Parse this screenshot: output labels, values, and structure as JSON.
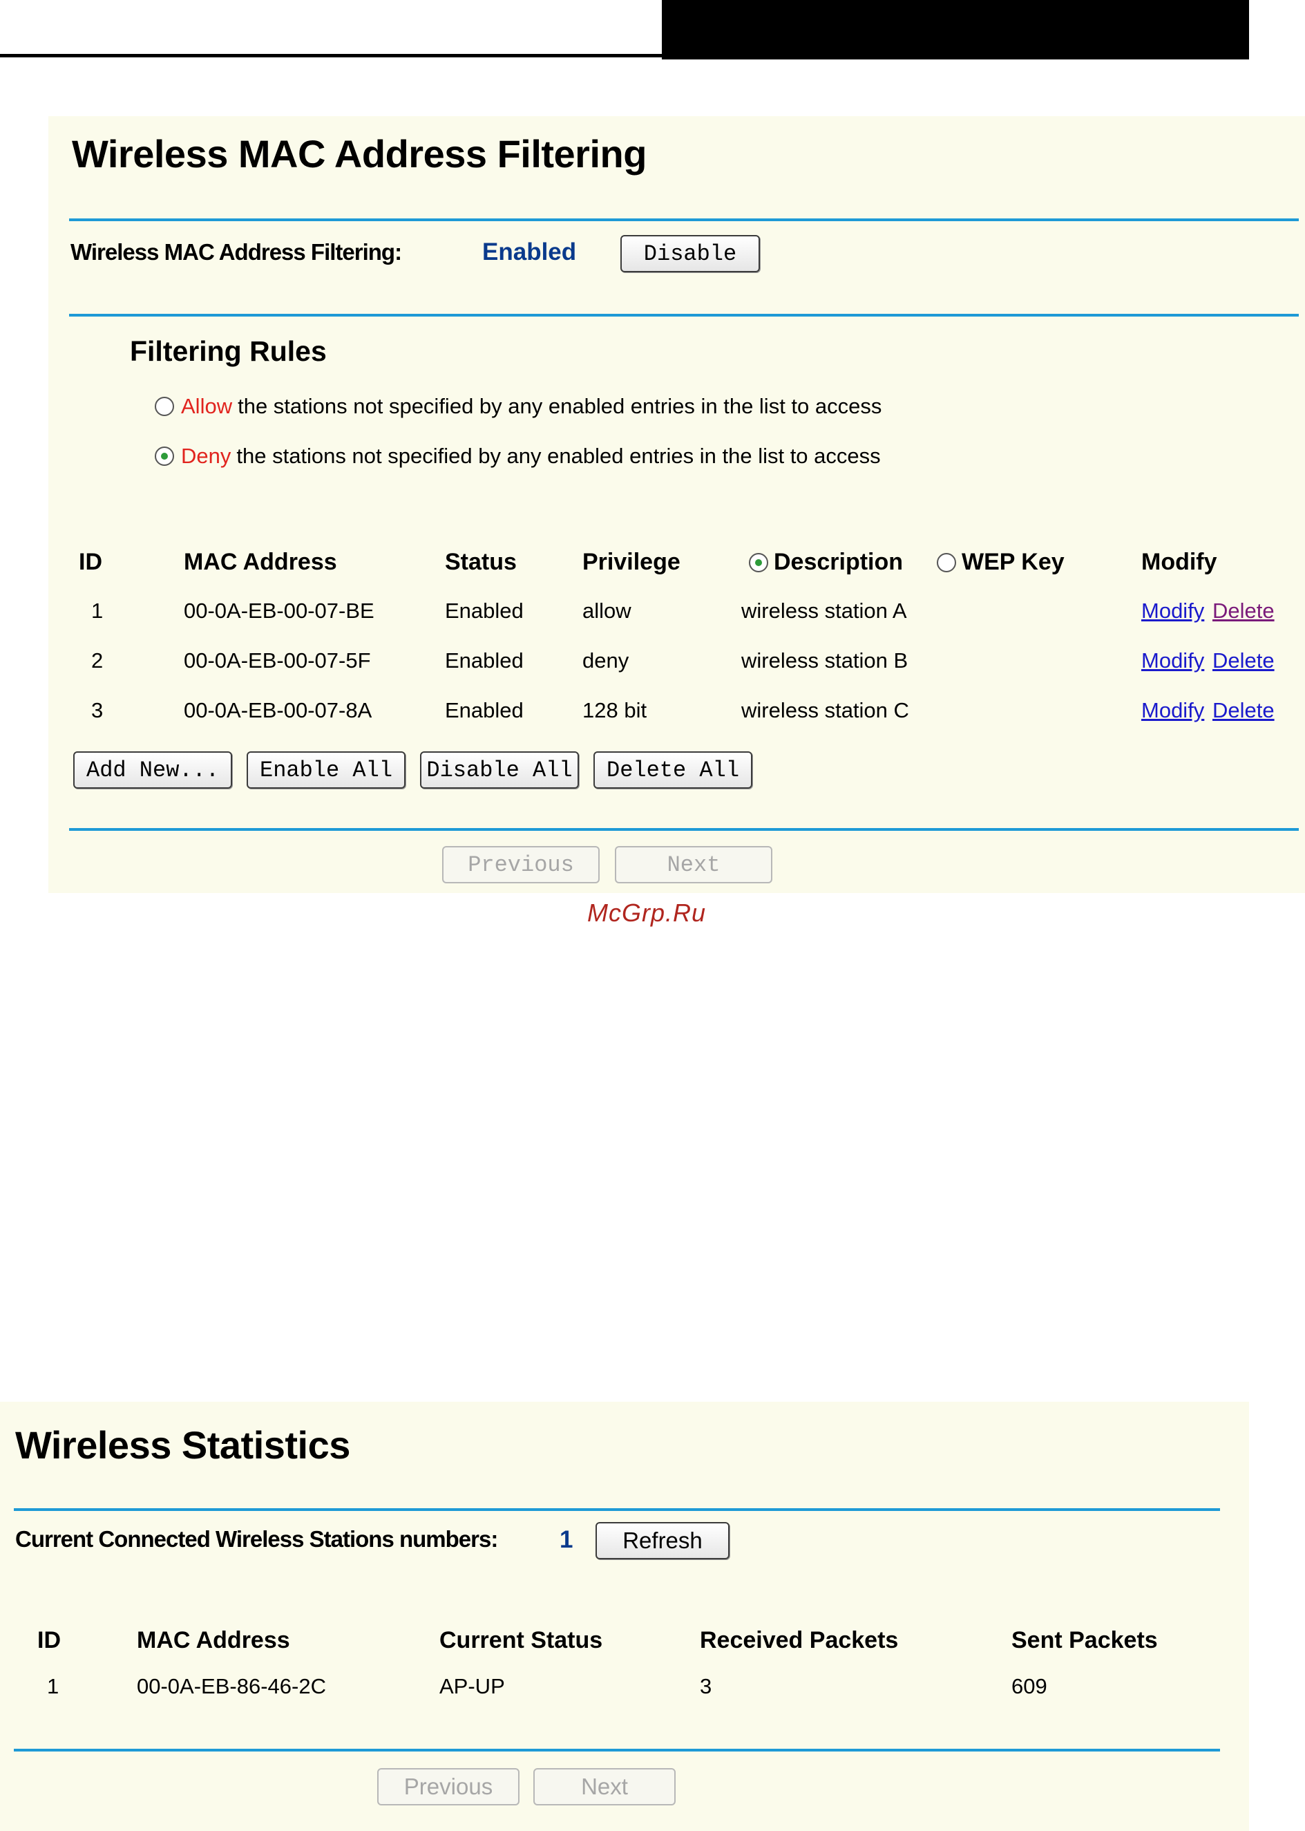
{
  "mac_filter": {
    "title": "Wireless MAC Address Filtering",
    "status_label": "Wireless MAC Address Filtering:",
    "status_value": "Enabled",
    "disable_button": "Disable",
    "rules_heading": "Filtering Rules",
    "rule_allow": {
      "keyword": "Allow",
      "text": "the stations not specified by any enabled entries in the list to access",
      "selected": false
    },
    "rule_deny": {
      "keyword": "Deny",
      "text": "the stations not specified by any enabled entries in the list to access",
      "selected": true
    },
    "columns": {
      "id": "ID",
      "mac": "MAC Address",
      "status": "Status",
      "privilege": "Privilege",
      "description": "Description",
      "wep_key": "WEP Key",
      "modify": "Modify"
    },
    "description_selected": true,
    "rows": [
      {
        "id": "1",
        "mac": "00-0A-EB-00-07-BE",
        "status": "Enabled",
        "privilege": "allow",
        "description": "wireless station A",
        "modify": "Modify",
        "delete": "Delete"
      },
      {
        "id": "2",
        "mac": "00-0A-EB-00-07-5F",
        "status": "Enabled",
        "privilege": "deny",
        "description": "wireless station B",
        "modify": "Modify",
        "delete": "Delete"
      },
      {
        "id": "3",
        "mac": "00-0A-EB-00-07-8A",
        "status": "Enabled",
        "privilege": "128 bit",
        "description": "wireless station C",
        "modify": "Modify",
        "delete": "Delete"
      }
    ],
    "actions": {
      "add_new": "Add New...",
      "enable_all": "Enable All",
      "disable_all": "Disable All",
      "delete_all": "Delete All"
    },
    "nav": {
      "previous": "Previous",
      "next": "Next"
    }
  },
  "watermark": "McGrp.Ru",
  "stats": {
    "title": "Wireless Statistics",
    "count_label": "Current Connected Wireless Stations numbers:",
    "count_value": "1",
    "refresh_button": "Refresh",
    "columns": {
      "id": "ID",
      "mac": "MAC Address",
      "current_status": "Current Status",
      "received": "Received Packets",
      "sent": "Sent Packets"
    },
    "rows": [
      {
        "id": "1",
        "mac": "00-0A-EB-86-46-2C",
        "current_status": "AP-UP",
        "received": "3",
        "sent": "609"
      }
    ],
    "nav": {
      "previous": "Previous",
      "next": "Next"
    }
  },
  "colors": {
    "rule": "#1e9ad6",
    "panel_bg": "#fbfbeb",
    "status_blue": "#0a3a8c",
    "keyword_red": "#e1241e",
    "link_blue": "#1a1acc",
    "link_visited": "#7a1a7a"
  }
}
